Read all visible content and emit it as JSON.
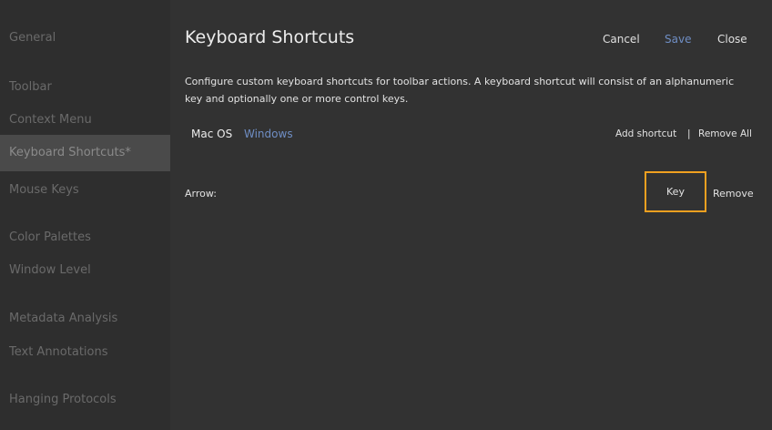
{
  "sidebar": {
    "items": [
      {
        "label": "General"
      },
      {
        "label": "Toolbar"
      },
      {
        "label": "Context Menu"
      },
      {
        "label": "Keyboard Shortcuts*"
      },
      {
        "label": "Mouse Keys"
      },
      {
        "label": "Color Palettes"
      },
      {
        "label": "Window Level"
      },
      {
        "label": "Metadata Analysis"
      },
      {
        "label": "Text Annotations"
      },
      {
        "label": "Hanging Protocols"
      }
    ]
  },
  "header": {
    "title": "Keyboard Shortcuts",
    "cancel_label": "Cancel",
    "save_label": "Save",
    "close_label": "Close"
  },
  "description": "Configure custom keyboard shortcuts for toolbar actions. A keyboard shortcut will consist of an alphanumeric key and optionally one or more control keys.",
  "os_tabs": {
    "mac": "Mac OS",
    "windows": "Windows"
  },
  "actions": {
    "add_shortcut": "Add shortcut",
    "separator": "|",
    "remove_all": "Remove All"
  },
  "shortcut_row": {
    "label": "Arrow:",
    "key_placeholder": "Key",
    "remove_label": "Remove"
  },
  "colors": {
    "accent_link": "#6f8ec4",
    "focus_border": "#f0a020",
    "sidebar_bg": "#2e2e2e",
    "main_bg": "#323232"
  }
}
